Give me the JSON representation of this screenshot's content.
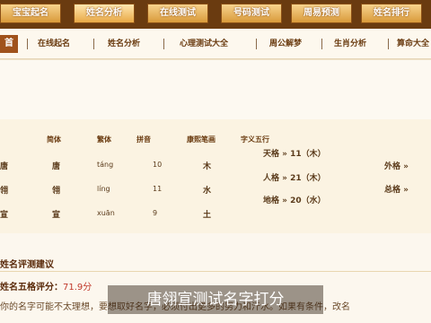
{
  "top_tabs": [
    "宝宝起名",
    "姓名分析",
    "在线测试",
    "号码测试",
    "周易预测",
    "姓名排行"
  ],
  "sub_nav": {
    "first": "首",
    "items": [
      "在线起名",
      "姓名分析",
      "心理测试大全",
      "周公解梦",
      "生肖分析",
      "算命大全"
    ]
  },
  "table": {
    "headers": [
      "简体",
      "繁体",
      "拼音",
      "康熙笔画",
      "字义五行"
    ],
    "rows": [
      {
        "hanzi": "唐",
        "trad": "唐",
        "pinyin": "táng",
        "strokes": "10",
        "wuxing": "木"
      },
      {
        "hanzi": "翎",
        "trad": "翎",
        "pinyin": "líng",
        "strokes": "11",
        "wuxing": "水"
      },
      {
        "hanzi": "宣",
        "trad": "宣",
        "pinyin": "xuān",
        "strokes": "9",
        "wuxing": "土"
      }
    ]
  },
  "wuge": [
    {
      "label": "天格",
      "value": "11（木）"
    },
    {
      "label": "人格",
      "value": "21（木）"
    },
    {
      "label": "地格",
      "value": "20（水）"
    }
  ],
  "wuge_right": [
    {
      "label": "外格"
    },
    {
      "label": "总格"
    }
  ],
  "section": {
    "title": "姓名评测建议",
    "score_label": "姓名五格评分：",
    "score_value": "71.9分",
    "description": "你的名字可能不太理想，要想取好名字，必须付出更多的努力和汗水。如果有条件，改名"
  },
  "caption": "唐翎宣测试名字打分"
}
